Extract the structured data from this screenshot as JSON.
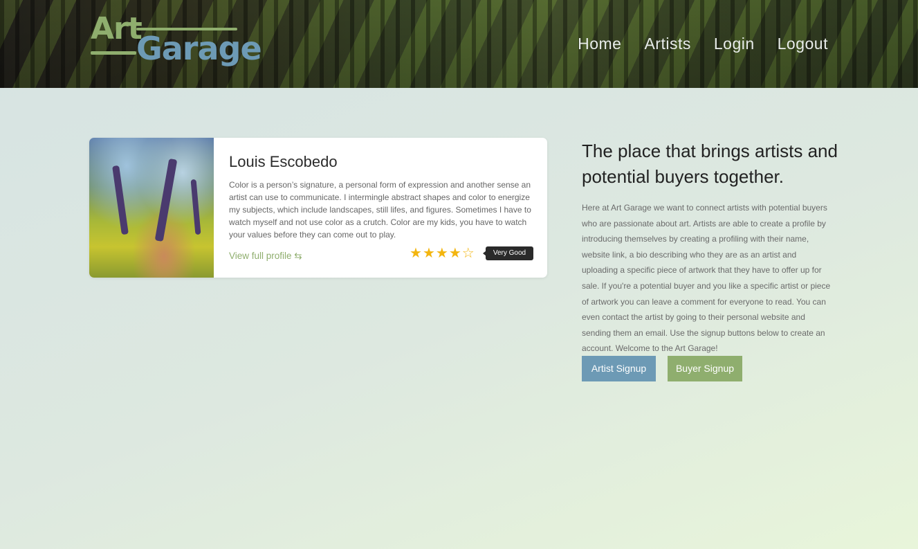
{
  "header": {
    "logo": {
      "part1": "Art",
      "part2": "Garage"
    },
    "nav": [
      {
        "label": "Home"
      },
      {
        "label": "Artists"
      },
      {
        "label": "Login"
      },
      {
        "label": "Logout"
      }
    ]
  },
  "artist_card": {
    "name": "Louis Escobedo",
    "bio": "Color is a person’s signature, a personal form of expression and another sense an artist can use to communicate. I intermingle abstract shapes and color to energize my subjects, which include landscapes, still lifes, and figures. Sometimes I have to watch myself and not use color as a crutch. Color are my kids, you have to watch your values before they can come out to play.",
    "profile_link": "View full profile ⇆",
    "rating": {
      "value": 4,
      "max": 5,
      "label": "Very Good"
    }
  },
  "intro": {
    "tagline": "The place that brings artists and potential buyers together.",
    "text": "Here at Art Garage we want to connect artists with potential buyers who are passionate about art. Artists are able to create a profile by introducing themselves by creating a profiling with their name, website link, a bio describing who they are as an artist and uploading a specific piece of artwork that they have to offer up for sale. If you're a potential buyer and you like a specific artist or piece of artwork you can leave a comment for everyone to read. You can even contact the artist by going to their personal website and sending them an email. Use the signup buttons below to create an account. Welcome to the Art Garage!",
    "buttons": {
      "artist": "Artist Signup",
      "buyer": "Buyer Signup"
    }
  },
  "colors": {
    "green_accent": "#8fae6e",
    "blue_accent": "#6d9ab5",
    "star": "#f3b50f"
  }
}
